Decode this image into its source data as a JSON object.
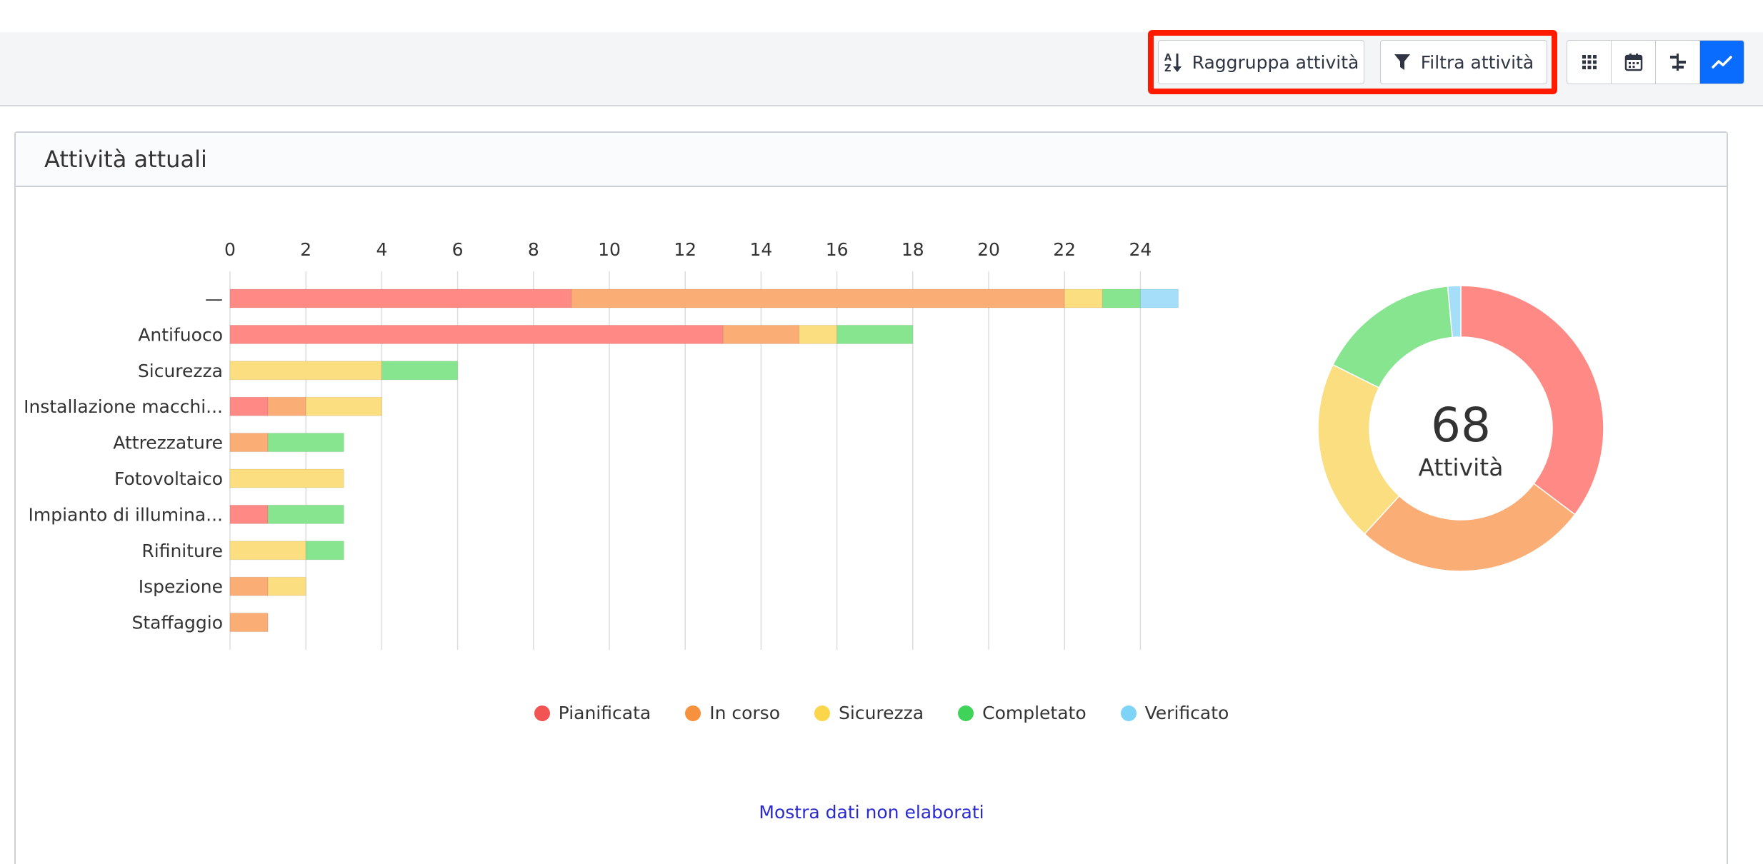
{
  "toolbar": {
    "group_label": "Raggruppa attività",
    "filter_label": "Filtra attività",
    "views": [
      "grid-view-icon",
      "calendar-view-icon",
      "gantt-view-icon",
      "chart-view-icon"
    ],
    "active_view": "chart-view-icon"
  },
  "panel": {
    "title": "Attività attuali"
  },
  "donut": {
    "total": "68",
    "label": "Attività"
  },
  "raw_link": "Mostra dati non elaborati",
  "colors": {
    "Pianificata": "#ff8a85",
    "In corso": "#fbad76",
    "Sicurezza": "#fbde80",
    "Completato": "#87e58f",
    "Verificato": "#a5def8",
    "accent": "#0a6cff",
    "highlight": "#ff1a00"
  },
  "legend": [
    {
      "name": "Pianificata",
      "dot": "#f25454"
    },
    {
      "name": "In corso",
      "dot": "#f7913d"
    },
    {
      "name": "Sicurezza",
      "dot": "#fbd54a"
    },
    {
      "name": "Completato",
      "dot": "#3fd35a"
    },
    {
      "name": "Verificato",
      "dot": "#7dd4f7"
    }
  ],
  "chart_data": [
    {
      "type": "bar",
      "orientation": "horizontal",
      "stacked": true,
      "categories": [
        "—",
        "Antifuoco",
        "Sicurezza",
        "Installazione macchi...",
        "Attrezzature",
        "Fotovoltaico",
        "Impianto di illumina...",
        "Rifiniture",
        "Ispezione",
        "Staffaggio"
      ],
      "series": [
        {
          "name": "Pianificata",
          "values": [
            9,
            13,
            0,
            1,
            0,
            0,
            1,
            0,
            0,
            0
          ]
        },
        {
          "name": "In corso",
          "values": [
            13,
            2,
            0,
            1,
            1,
            0,
            0,
            0,
            1,
            1
          ]
        },
        {
          "name": "Sicurezza",
          "values": [
            1,
            1,
            4,
            2,
            0,
            3,
            0,
            2,
            1,
            0
          ]
        },
        {
          "name": "Completato",
          "values": [
            1,
            2,
            2,
            0,
            2,
            0,
            2,
            1,
            0,
            0
          ]
        },
        {
          "name": "Verificato",
          "values": [
            1,
            0,
            0,
            0,
            0,
            0,
            0,
            0,
            0,
            0
          ]
        }
      ],
      "xticks": [
        "0",
        "2",
        "4",
        "6",
        "8",
        "10",
        "12",
        "14",
        "16",
        "18",
        "20",
        "22",
        "24"
      ],
      "xlim": [
        0,
        24
      ],
      "axis_position": "top",
      "grid": true
    },
    {
      "type": "pie",
      "donut": true,
      "labels": [
        "Pianificata",
        "In corso",
        "Sicurezza",
        "Completato",
        "Verificato"
      ],
      "values": [
        24,
        18,
        14,
        11,
        1
      ],
      "center_text": "68 Attività"
    }
  ]
}
